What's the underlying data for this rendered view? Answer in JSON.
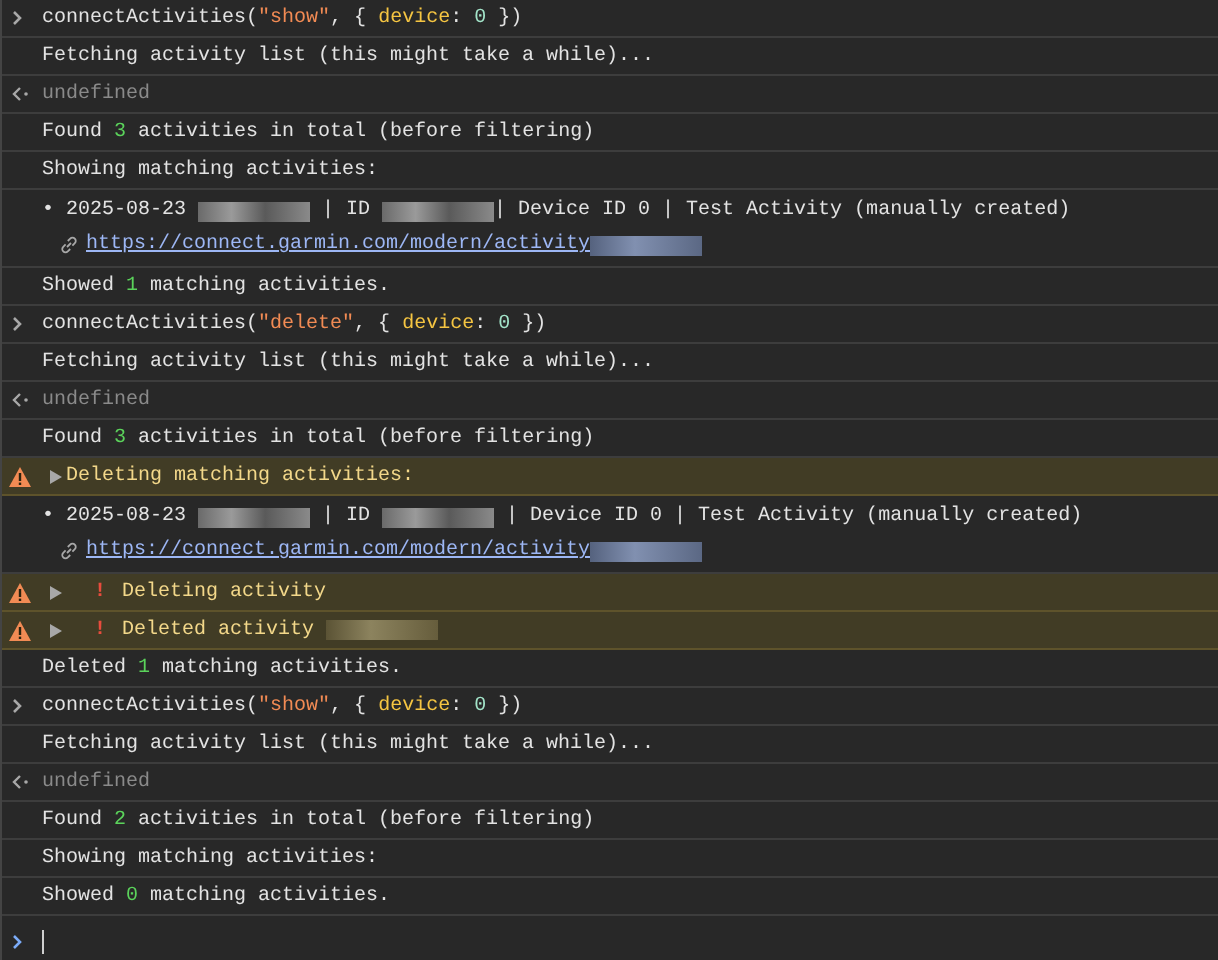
{
  "entries": [
    {
      "kind": "input",
      "segments": [
        {
          "kind": "plain",
          "text": "connectActivities("
        },
        {
          "kind": "string",
          "text": "\"show\""
        },
        {
          "kind": "plain",
          "text": ", { "
        },
        {
          "kind": "key",
          "text": "device"
        },
        {
          "kind": "plain",
          "text": ": "
        },
        {
          "kind": "literal",
          "text": "0"
        },
        {
          "kind": "plain",
          "text": " })"
        }
      ]
    },
    {
      "kind": "log",
      "segments": [
        {
          "kind": "plain",
          "text": "Fetching activity list (this might take a while)..."
        }
      ]
    },
    {
      "kind": "result",
      "text": "undefined"
    },
    {
      "kind": "log",
      "segments": [
        {
          "kind": "plain",
          "text": "Found "
        },
        {
          "kind": "number",
          "text": "3"
        },
        {
          "kind": "plain",
          "text": " activities in total (before filtering)"
        }
      ]
    },
    {
      "kind": "log",
      "segments": [
        {
          "kind": "plain",
          "text": "Showing matching activities:"
        }
      ]
    },
    {
      "kind": "list",
      "segments": [
        {
          "kind": "plain",
          "text": "• 2025-08-23 "
        },
        {
          "kind": "redacted"
        },
        {
          "kind": "plain",
          "text": " | ID "
        },
        {
          "kind": "redacted"
        },
        {
          "kind": "plain",
          "text": "| Device ID 0 | Test Activity (manually created)"
        }
      ],
      "link": "https://connect.garmin.com/modern/activity"
    },
    {
      "kind": "log",
      "segments": [
        {
          "kind": "plain",
          "text": "Showed "
        },
        {
          "kind": "number",
          "text": "1"
        },
        {
          "kind": "plain",
          "text": " matching activities."
        }
      ]
    },
    {
      "kind": "input",
      "segments": [
        {
          "kind": "plain",
          "text": "connectActivities("
        },
        {
          "kind": "string",
          "text": "\"delete\""
        },
        {
          "kind": "plain",
          "text": ", { "
        },
        {
          "kind": "key",
          "text": "device"
        },
        {
          "kind": "plain",
          "text": ": "
        },
        {
          "kind": "literal",
          "text": "0"
        },
        {
          "kind": "plain",
          "text": " })"
        }
      ]
    },
    {
      "kind": "log",
      "segments": [
        {
          "kind": "plain",
          "text": "Fetching activity list (this might take a while)..."
        }
      ]
    },
    {
      "kind": "result",
      "text": "undefined"
    },
    {
      "kind": "log",
      "segments": [
        {
          "kind": "plain",
          "text": "Found "
        },
        {
          "kind": "number",
          "text": "3"
        },
        {
          "kind": "plain",
          "text": " activities in total (before filtering)"
        }
      ]
    },
    {
      "kind": "warning",
      "segments": [
        {
          "kind": "plain",
          "text": "Deleting matching activities:"
        }
      ]
    },
    {
      "kind": "list",
      "segments": [
        {
          "kind": "plain",
          "text": "• 2025-08-23 "
        },
        {
          "kind": "redacted"
        },
        {
          "kind": "plain",
          "text": " | ID "
        },
        {
          "kind": "redacted"
        },
        {
          "kind": "plain",
          "text": " | Device ID 0 | Test Activity (manually created)"
        }
      ],
      "link": "https://connect.garmin.com/modern/activity"
    },
    {
      "kind": "warning",
      "bang": "!",
      "segments": [
        {
          "kind": "plain",
          "text": "Deleting activity"
        }
      ]
    },
    {
      "kind": "warning",
      "bang": "!",
      "segments": [
        {
          "kind": "plain",
          "text": "Deleted activity "
        },
        {
          "kind": "redacted"
        }
      ]
    },
    {
      "kind": "log",
      "segments": [
        {
          "kind": "plain",
          "text": "Deleted "
        },
        {
          "kind": "number",
          "text": "1"
        },
        {
          "kind": "plain",
          "text": " matching activities."
        }
      ]
    },
    {
      "kind": "input",
      "segments": [
        {
          "kind": "plain",
          "text": "connectActivities("
        },
        {
          "kind": "string",
          "text": "\"show\""
        },
        {
          "kind": "plain",
          "text": ", { "
        },
        {
          "kind": "key",
          "text": "device"
        },
        {
          "kind": "plain",
          "text": ": "
        },
        {
          "kind": "literal",
          "text": "0"
        },
        {
          "kind": "plain",
          "text": " })"
        }
      ]
    },
    {
      "kind": "log",
      "segments": [
        {
          "kind": "plain",
          "text": "Fetching activity list (this might take a while)..."
        }
      ]
    },
    {
      "kind": "result",
      "text": "undefined"
    },
    {
      "kind": "log",
      "segments": [
        {
          "kind": "plain",
          "text": "Found "
        },
        {
          "kind": "number",
          "text": "2"
        },
        {
          "kind": "plain",
          "text": " activities in total (before filtering)"
        }
      ]
    },
    {
      "kind": "log",
      "segments": [
        {
          "kind": "plain",
          "text": "Showing matching activities:"
        }
      ]
    },
    {
      "kind": "log",
      "segments": [
        {
          "kind": "plain",
          "text": "Showed "
        },
        {
          "kind": "number",
          "text": "0"
        },
        {
          "kind": "plain",
          "text": " matching activities."
        }
      ]
    }
  ]
}
